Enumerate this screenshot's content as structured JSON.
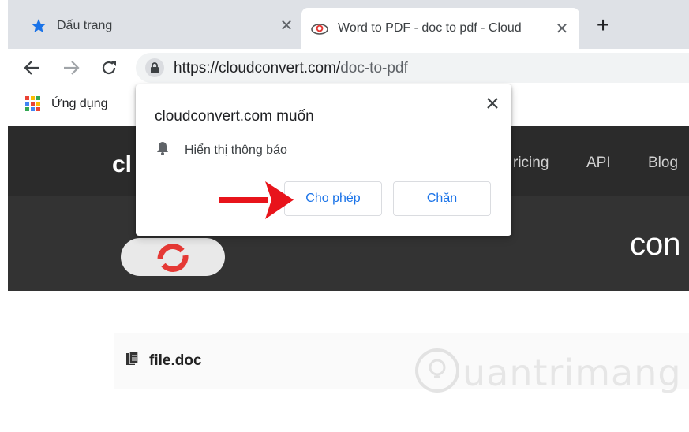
{
  "tabs": [
    {
      "title": "Dấu trang",
      "icon": "star-icon"
    },
    {
      "title": "Word to PDF - doc to pdf - Cloud",
      "icon": "cloudconvert-favicon-icon"
    }
  ],
  "omnibox": {
    "url_host": "https://cloudconvert.com/",
    "url_path": "doc-to-pdf"
  },
  "bookmarks": {
    "apps_label": "Ứng dụng"
  },
  "site": {
    "logo": "cl",
    "nav": [
      "ricing",
      "API",
      "Blog"
    ],
    "hero_title": "con",
    "file_name": "file.doc"
  },
  "popup": {
    "title": "cloudconvert.com muốn",
    "permission": "Hiển thị thông báo",
    "allow": "Cho phép",
    "block": "Chặn"
  },
  "watermark": {
    "text": "uantrimang"
  },
  "colors": {
    "accent": "#1a73e8",
    "arrow": "#e8141b",
    "site_nav": "#2b2b2b"
  }
}
